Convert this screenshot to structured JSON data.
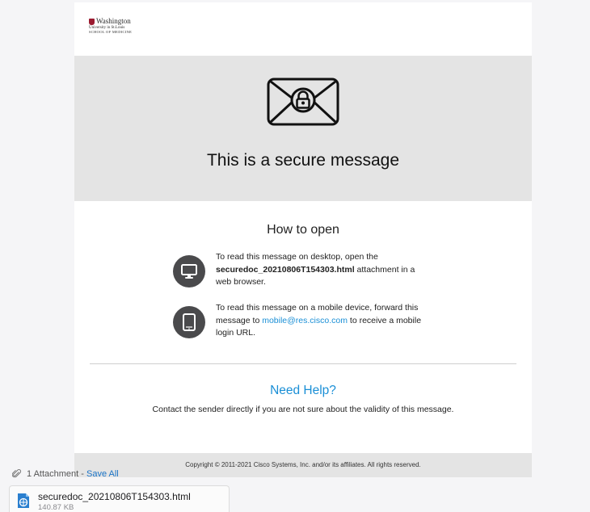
{
  "logo": {
    "line1": "Washington",
    "line2": "University in St.Louis",
    "line3": "School of Medicine"
  },
  "hero": {
    "icon": "secure-envelope-lock-icon",
    "title": "This is a secure message"
  },
  "instructions": {
    "heading": "How to open",
    "desktop": {
      "icon": "monitor-icon",
      "text_before": "To read this message on desktop, open the ",
      "filename": "securedoc_20210806T154303.html",
      "text_after": " attachment in a web browser."
    },
    "mobile": {
      "icon": "tablet-icon",
      "text_before": "To read this message on a mobile device, forward this message to ",
      "email": "mobile@res.cisco.com",
      "text_after": " to receive a mobile login URL."
    }
  },
  "help": {
    "heading": "Need Help?",
    "text": "Contact the sender directly if you are not sure about the validity of this message."
  },
  "footer": {
    "copyright": "Copyright © 2011-2021 Cisco Systems, Inc. and/or its affiliates. All rights reserved."
  },
  "attachments": {
    "summary": "1 Attachment",
    "separator": " - ",
    "save_all_label": "Save All",
    "items": [
      {
        "name": "securedoc_20210806T154303.html",
        "size": "140.87 KB",
        "icon": "html-file-icon"
      }
    ]
  },
  "colors": {
    "accent_link": "#1a8fd6",
    "band_gray": "#e4e4e4",
    "icon_circle": "#4a4a4c",
    "brand_red": "#9b1b30"
  }
}
